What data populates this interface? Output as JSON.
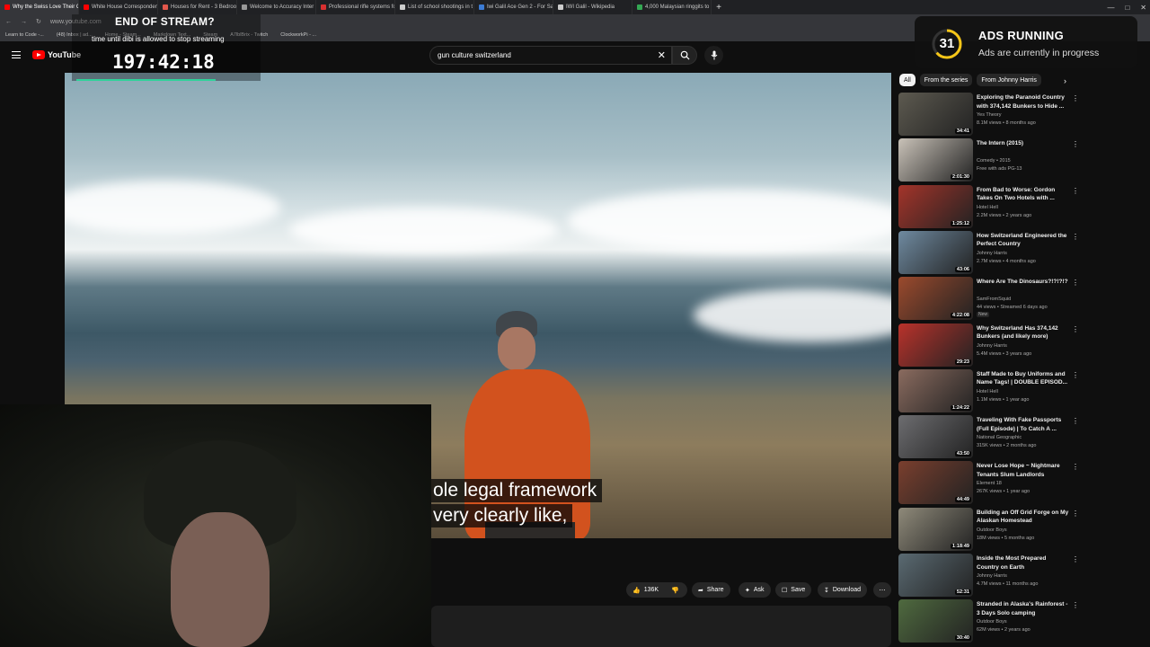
{
  "browser": {
    "tabs": [
      {
        "label": "Why the Swiss Love Their G",
        "color": "#ff0000"
      },
      {
        "label": "White House Corresponden",
        "color": "#ff0000"
      },
      {
        "label": "Houses for Rent - 3 Bedroo",
        "color": "#e2574c"
      },
      {
        "label": "Welcome to Accuracy Inter",
        "color": "#999999"
      },
      {
        "label": "Professional rifle systems fo",
        "color": "#d93030"
      },
      {
        "label": "List of school shootings in t",
        "color": "#cccccc"
      },
      {
        "label": "Iwi Galil Ace Gen 2 - For Sa",
        "color": "#3b7bd4"
      },
      {
        "label": "IWI Galil - Wikipedia",
        "color": "#cccccc"
      },
      {
        "label": "4,000 Malaysian ringgits to",
        "color": "#34a853"
      }
    ],
    "new_tab": "+",
    "url": "www.youtube.com",
    "bookmarks": [
      "Learn to Code -...",
      "(48) Inbox | ad...",
      "Home - Steam...",
      "Markdown Text...",
      "Steam",
      "A7lblBrix - Twitch",
      "ClockworkPi - ..."
    ]
  },
  "youtube": {
    "logo": "YouTube",
    "search_value": "gun culture switzerland",
    "colors": {
      "brand": "#ff0000",
      "background": "#0f0f0f"
    }
  },
  "video": {
    "caption_line1": "ole legal framework",
    "caption_line2": "very clearly like,"
  },
  "actions": {
    "likes": "136K",
    "share": "Share",
    "ask": "Ask",
    "save": "Save",
    "download": "Download"
  },
  "chips": [
    "All",
    "From the series",
    "From Johnny Harris"
  ],
  "recommendations": [
    {
      "title": "Exploring the Paranoid Country with 374,142 Bunkers to Hide ...",
      "channel": "Yes Theory",
      "meta": "8.1M views • 8 months ago",
      "duration": "34:41",
      "thumb": "#5d5a50"
    },
    {
      "title": "The Intern (2015)",
      "channel": "Comedy • 2015",
      "meta": "Free with ads  PG-13",
      "duration": "2:01:30",
      "thumb": "#c9c2b8"
    },
    {
      "title": "From Bad to Worse: Gordon Takes On Two Hotels with ...",
      "channel": "Hotel Hell",
      "meta": "2.2M views • 2 years ago",
      "duration": "1:25:12",
      "thumb": "#a4342a"
    },
    {
      "title": "How Switzerland Engineered the Perfect Country",
      "channel": "Johnny Harris",
      "meta": "2.7M views • 4 months ago",
      "duration": "43:06",
      "thumb": "#6f8aa0"
    },
    {
      "title": "Where Are The Dinosaurs?!?!?!?",
      "channel": "SamFromSquid",
      "meta": "44 views • Streamed 6 days ago",
      "duration": "4:22:08",
      "badge": "New",
      "thumb": "#9b4a2d"
    },
    {
      "title": "Why Switzerland Has 374,142 Bunkers (and likely more)",
      "channel": "Johnny Harris",
      "meta": "5.4M views • 3 years ago",
      "duration": "29:23",
      "thumb": "#b9322b"
    },
    {
      "title": "Staff Made to Buy Uniforms and Name Tags! | DOUBLE EPISOD...",
      "channel": "Hotel Hell",
      "meta": "1.1M views • 1 year ago",
      "duration": "1:24:22",
      "thumb": "#8a6b5f"
    },
    {
      "title": "Traveling With Fake Passports (Full Episode) | To Catch A ...",
      "channel": "National Geographic",
      "meta": "315K views • 2 months ago",
      "duration": "43:50",
      "thumb": "#6d6d70"
    },
    {
      "title": "Never Lose Hope ~ Nightmare Tenants Slum Landlords",
      "channel": "Element 18",
      "meta": "267K views • 1 year ago",
      "duration": "44:49",
      "thumb": "#7a3f2e"
    },
    {
      "title": "Building an Off Grid Forge on My Alaskan Homestead",
      "channel": "Outdoor Boys",
      "meta": "18M views • 5 months ago",
      "duration": "1:18:49",
      "thumb": "#8f8a7a"
    },
    {
      "title": "Inside the Most Prepared Country on Earth",
      "channel": "Johnny Harris",
      "meta": "4.7M views • 11 months ago",
      "duration": "52:31",
      "thumb": "#5a6a72"
    },
    {
      "title": "Stranded in Alaska's Rainforest - 3 Days Solo camping",
      "channel": "Outdoor Boys",
      "meta": "62M views • 2 years ago",
      "duration": "30:40",
      "thumb": "#4f6a3f"
    }
  ],
  "overlay_stream": {
    "title": "END OF STREAM?",
    "subtitle": "time until dibi is allowed to stop streaming",
    "timer": "197:42:18",
    "bar_color": "#2fd29a"
  },
  "overlay_ads": {
    "count": "31",
    "heading": "ADS RUNNING",
    "subtitle": "Ads are currently in progress",
    "accent": "#f5c518"
  }
}
